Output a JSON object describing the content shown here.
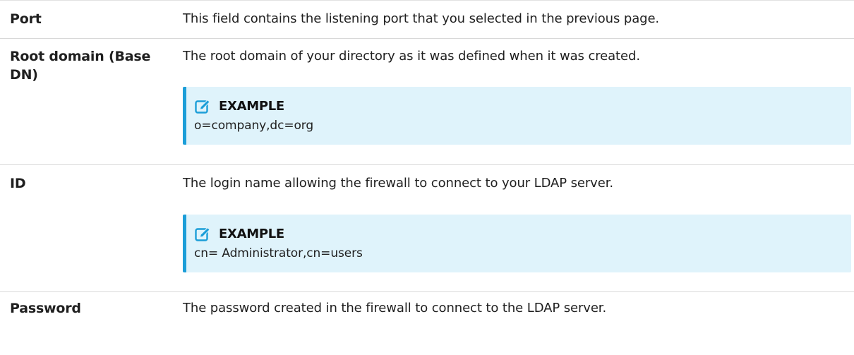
{
  "rows": [
    {
      "name": "Port",
      "description": "This field contains the listening port that you selected in the previous page."
    },
    {
      "name": "Root domain (Base DN)",
      "description": "The root domain of your directory as it was defined when it was created.",
      "note": {
        "icon": "pencil-square-icon",
        "title": "EXAMPLE",
        "text": "o=company,dc=org"
      }
    },
    {
      "name": "ID",
      "description": "The login name allowing the firewall to connect to your LDAP server.",
      "note": {
        "icon": "pencil-square-icon",
        "title": "EXAMPLE",
        "text": "cn= Administrator,cn=users"
      }
    },
    {
      "name": "Password",
      "description": "The password created in the firewall to connect to the LDAP server."
    }
  ],
  "colors": {
    "note_background": "#dff3fb",
    "note_accent": "#1c9ed8",
    "row_border": "#d8d8d8"
  }
}
